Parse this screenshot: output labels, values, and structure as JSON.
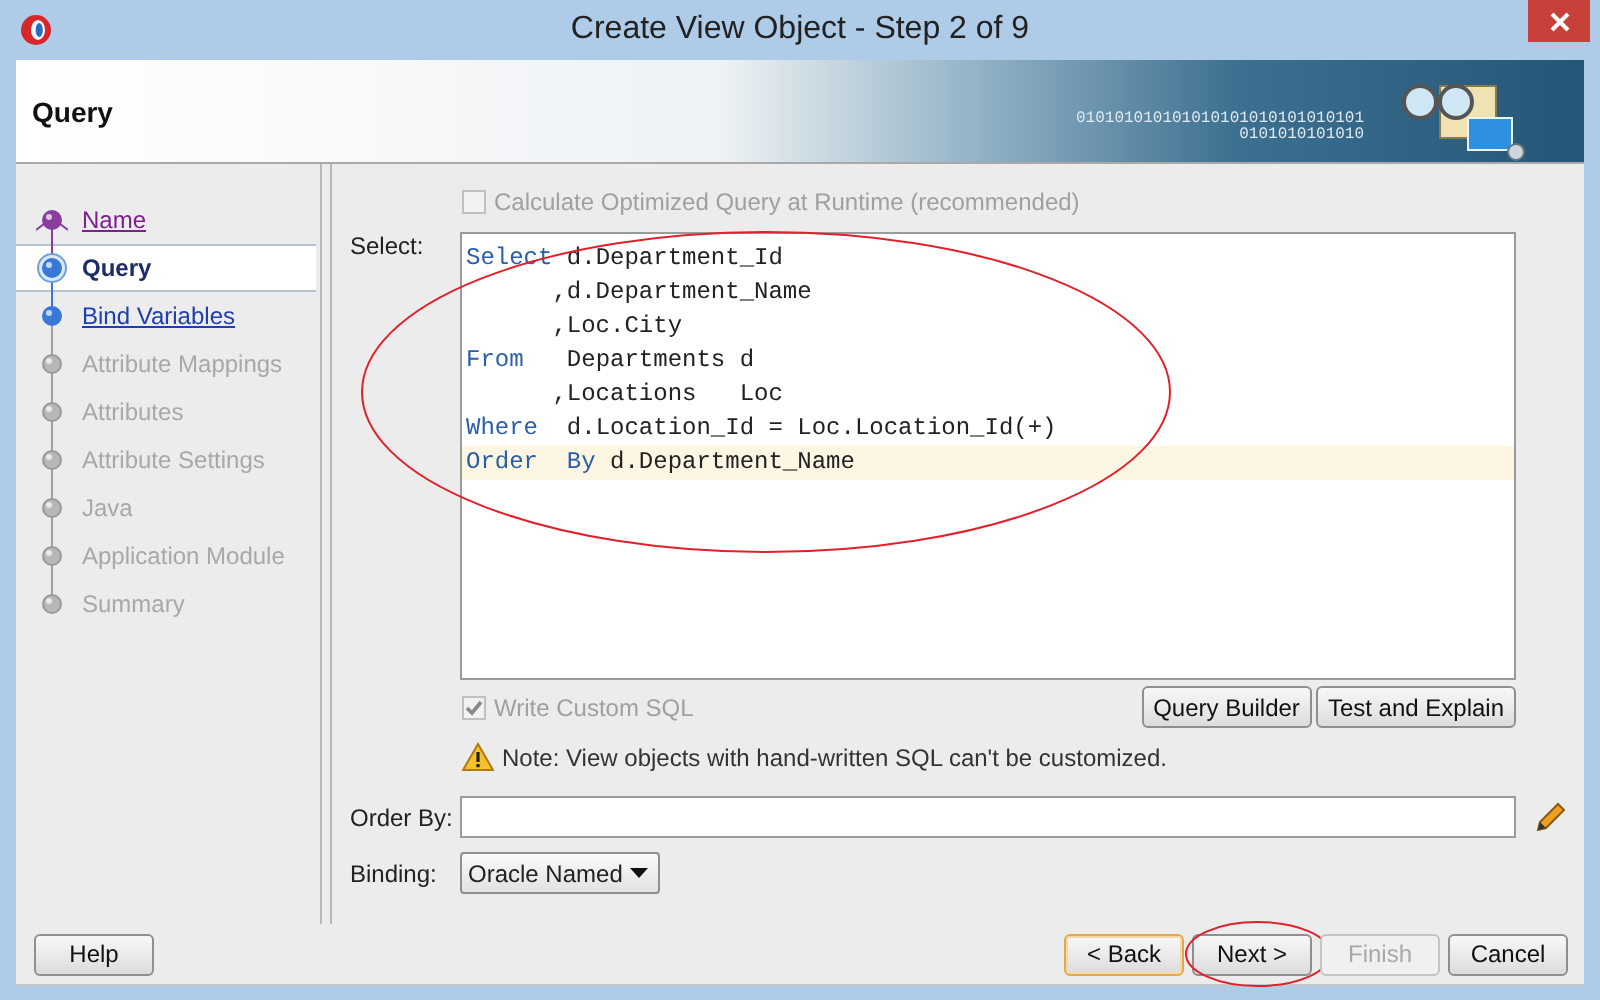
{
  "window": {
    "title": "Create View Object - Step 2 of 9"
  },
  "header": {
    "title": "Query",
    "banner_digits": [
      "010101010101010101010101010101",
      "0101010101010"
    ]
  },
  "steps": [
    {
      "label": "Name",
      "kind": "visited",
      "selected": false
    },
    {
      "label": "Query",
      "kind": "available",
      "selected": true
    },
    {
      "label": "Bind Variables",
      "kind": "available",
      "selected": false
    },
    {
      "label": "Attribute Mappings",
      "kind": "disabled",
      "selected": false
    },
    {
      "label": "Attributes",
      "kind": "disabled",
      "selected": false
    },
    {
      "label": "Attribute Settings",
      "kind": "disabled",
      "selected": false
    },
    {
      "label": "Java",
      "kind": "disabled",
      "selected": false
    },
    {
      "label": "Application Module",
      "kind": "disabled",
      "selected": false
    },
    {
      "label": "Summary",
      "kind": "disabled",
      "selected": false
    }
  ],
  "optimize_checkbox": {
    "label": "Calculate Optimized Query at Runtime (recommended)",
    "checked": false,
    "disabled": true
  },
  "select_label": "Select:",
  "sql_editor": {
    "circled": true,
    "lines": [
      {
        "keyword": "Select",
        "code": " d.Department_Id",
        "current": false
      },
      {
        "code": "      ,d.Department_Name",
        "current": false
      },
      {
        "code": "      ,Loc.City",
        "current": false
      },
      {
        "keyword": "From",
        "code": "   Departments d",
        "current": false
      },
      {
        "code": "      ,Locations   Loc",
        "current": false
      },
      {
        "keyword": "Where",
        "code": "  d.Location_Id = Loc.Location_Id(+)",
        "current": false
      },
      {
        "keyword": "Order  By",
        "code": " d.Department_Name",
        "current": true
      }
    ]
  },
  "custom_sql_checkbox": {
    "label": "Write Custom SQL",
    "checked": true,
    "disabled": true
  },
  "editor_buttons": [
    "Query Builder",
    "Test and Explain"
  ],
  "note": "Note: View objects with hand-written SQL can't be customized.",
  "order_by": {
    "label": "Order By:"
  },
  "binding": {
    "label": "Binding:",
    "value": "Oracle Named"
  },
  "help_button": "Help",
  "buttons": [
    {
      "label": "< Back",
      "kind": "default",
      "disabled": false,
      "circled": false
    },
    {
      "label": "Next >",
      "kind": "normal",
      "disabled": false,
      "circled": true
    },
    {
      "label": "Finish",
      "kind": "normal",
      "disabled": true,
      "circled": false
    },
    {
      "label": "Cancel",
      "kind": "normal",
      "disabled": false,
      "circled": false
    }
  ]
}
